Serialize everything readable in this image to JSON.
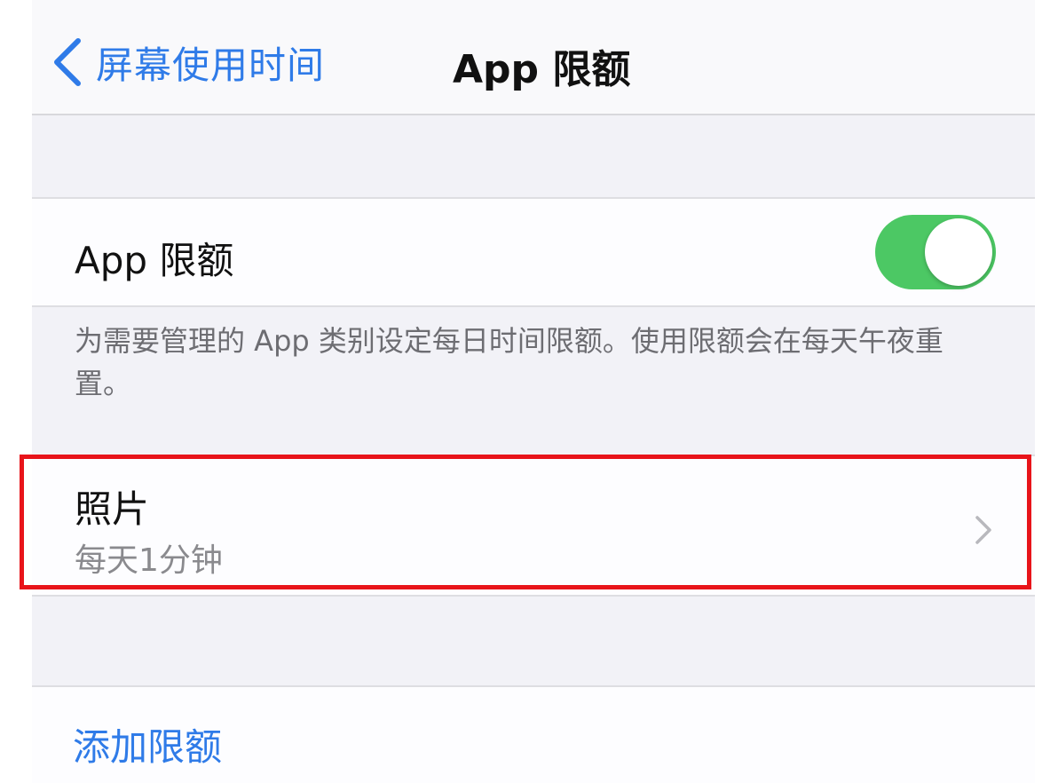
{
  "navbar": {
    "back_label": "屏幕使用时间",
    "title": "App 限额"
  },
  "app_limits_toggle": {
    "label": "App 限额",
    "state": "on"
  },
  "footer_note": "为需要管理的 App 类别设定每日时间限额。使用限额会在每天午夜重置。",
  "limit_item": {
    "title": "照片",
    "subtitle": "每天1分钟"
  },
  "add_limit_label": "添加限额",
  "colors": {
    "accent": "#2f7be8",
    "toggle_on": "#4cc864",
    "highlight": "#e8141a"
  },
  "icons": {
    "back": "chevron-left-icon",
    "disclosure": "chevron-right-icon"
  }
}
